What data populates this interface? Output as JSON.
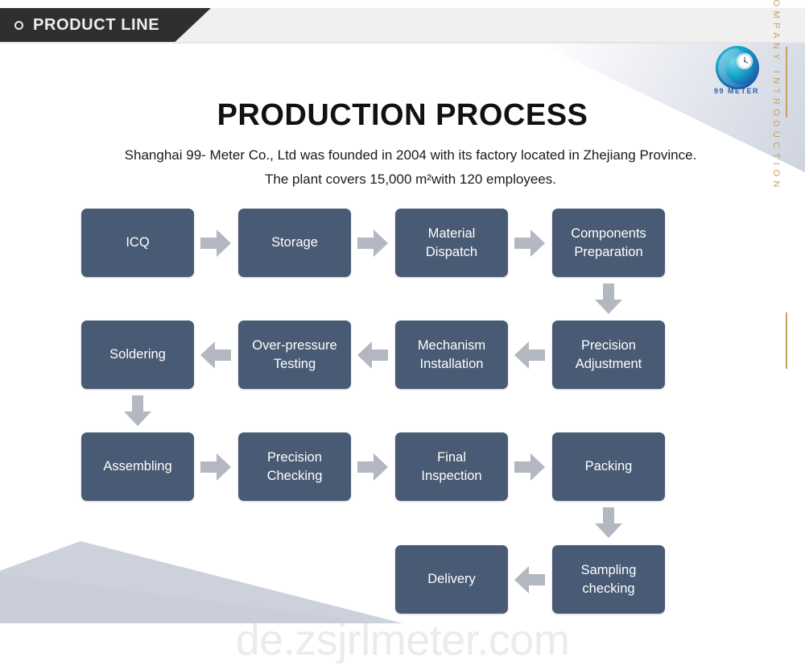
{
  "header": {
    "bullet_icon": "circle-icon",
    "label": "PRODUCT LINE"
  },
  "brand": {
    "logo_icon": "99meter-swirl-logo",
    "logo_text": "99 METER"
  },
  "side_rail": {
    "text": "COMPANY INTRODUCTION",
    "color": "#c3a35a"
  },
  "title": "PRODUCTION PROCESS",
  "description": "Shanghai 99- Meter Co., Ltd was founded in 2004 with its factory located in Zhejiang Province. The plant covers 15,000 m²with 120 employees.",
  "watermark": "de.zsjrlmeter.com",
  "colors": {
    "node_fill": "#485a74",
    "arrow_fill": "#b3b7bf",
    "header_bg": "#2f2f2f",
    "accent_gold": "#c3a35a"
  },
  "chart_data": {
    "type": "diagram",
    "title": "PRODUCTION PROCESS",
    "nodes": [
      {
        "id": "icq",
        "label": "ICQ",
        "row": 1,
        "col": 1
      },
      {
        "id": "storage",
        "label": "Storage",
        "row": 1,
        "col": 2
      },
      {
        "id": "material",
        "label": "Material\nDispatch",
        "row": 1,
        "col": 3
      },
      {
        "id": "components",
        "label": "Components\nPreparation",
        "row": 1,
        "col": 4
      },
      {
        "id": "soldering",
        "label": "Soldering",
        "row": 2,
        "col": 1
      },
      {
        "id": "overpress",
        "label": "Over-pressure\nTesting",
        "row": 2,
        "col": 2
      },
      {
        "id": "mechanism",
        "label": "Mechanism\nInstallation",
        "row": 2,
        "col": 3
      },
      {
        "id": "precadj",
        "label": "Precision\nAdjustment",
        "row": 2,
        "col": 4
      },
      {
        "id": "assembling",
        "label": "Assembling",
        "row": 3,
        "col": 1
      },
      {
        "id": "preccheck",
        "label": "Precision\nChecking",
        "row": 3,
        "col": 2
      },
      {
        "id": "final",
        "label": "Final\nInspection",
        "row": 3,
        "col": 3
      },
      {
        "id": "packing",
        "label": "Packing",
        "row": 3,
        "col": 4
      },
      {
        "id": "delivery",
        "label": "Delivery",
        "row": 4,
        "col": 3
      },
      {
        "id": "sampling",
        "label": "Sampling\nchecking",
        "row": 4,
        "col": 4
      }
    ],
    "edges": [
      {
        "from": "icq",
        "to": "storage",
        "direction": "right"
      },
      {
        "from": "storage",
        "to": "material",
        "direction": "right"
      },
      {
        "from": "material",
        "to": "components",
        "direction": "right"
      },
      {
        "from": "components",
        "to": "precadj",
        "direction": "down"
      },
      {
        "from": "precadj",
        "to": "mechanism",
        "direction": "left"
      },
      {
        "from": "mechanism",
        "to": "overpress",
        "direction": "left"
      },
      {
        "from": "overpress",
        "to": "soldering",
        "direction": "left"
      },
      {
        "from": "soldering",
        "to": "assembling",
        "direction": "down"
      },
      {
        "from": "assembling",
        "to": "preccheck",
        "direction": "right"
      },
      {
        "from": "preccheck",
        "to": "final",
        "direction": "right"
      },
      {
        "from": "final",
        "to": "packing",
        "direction": "right"
      },
      {
        "from": "packing",
        "to": "sampling",
        "direction": "down"
      },
      {
        "from": "sampling",
        "to": "delivery",
        "direction": "left"
      }
    ]
  },
  "nodes": {
    "icq": "ICQ",
    "storage": "Storage",
    "material_l1": "Material",
    "material_l2": "Dispatch",
    "components_l1": "Components",
    "components_l2": "Preparation",
    "soldering": "Soldering",
    "overpress_l1": "Over-pressure",
    "overpress_l2": "Testing",
    "mechanism_l1": "Mechanism",
    "mechanism_l2": "Installation",
    "precadj_l1": "Precision",
    "precadj_l2": "Adjustment",
    "assembling": "Assembling",
    "preccheck_l1": "Precision",
    "preccheck_l2": "Checking",
    "final_l1": "Final",
    "final_l2": "Inspection",
    "packing": "Packing",
    "delivery": "Delivery",
    "sampling_l1": "Sampling",
    "sampling_l2": "checking"
  }
}
